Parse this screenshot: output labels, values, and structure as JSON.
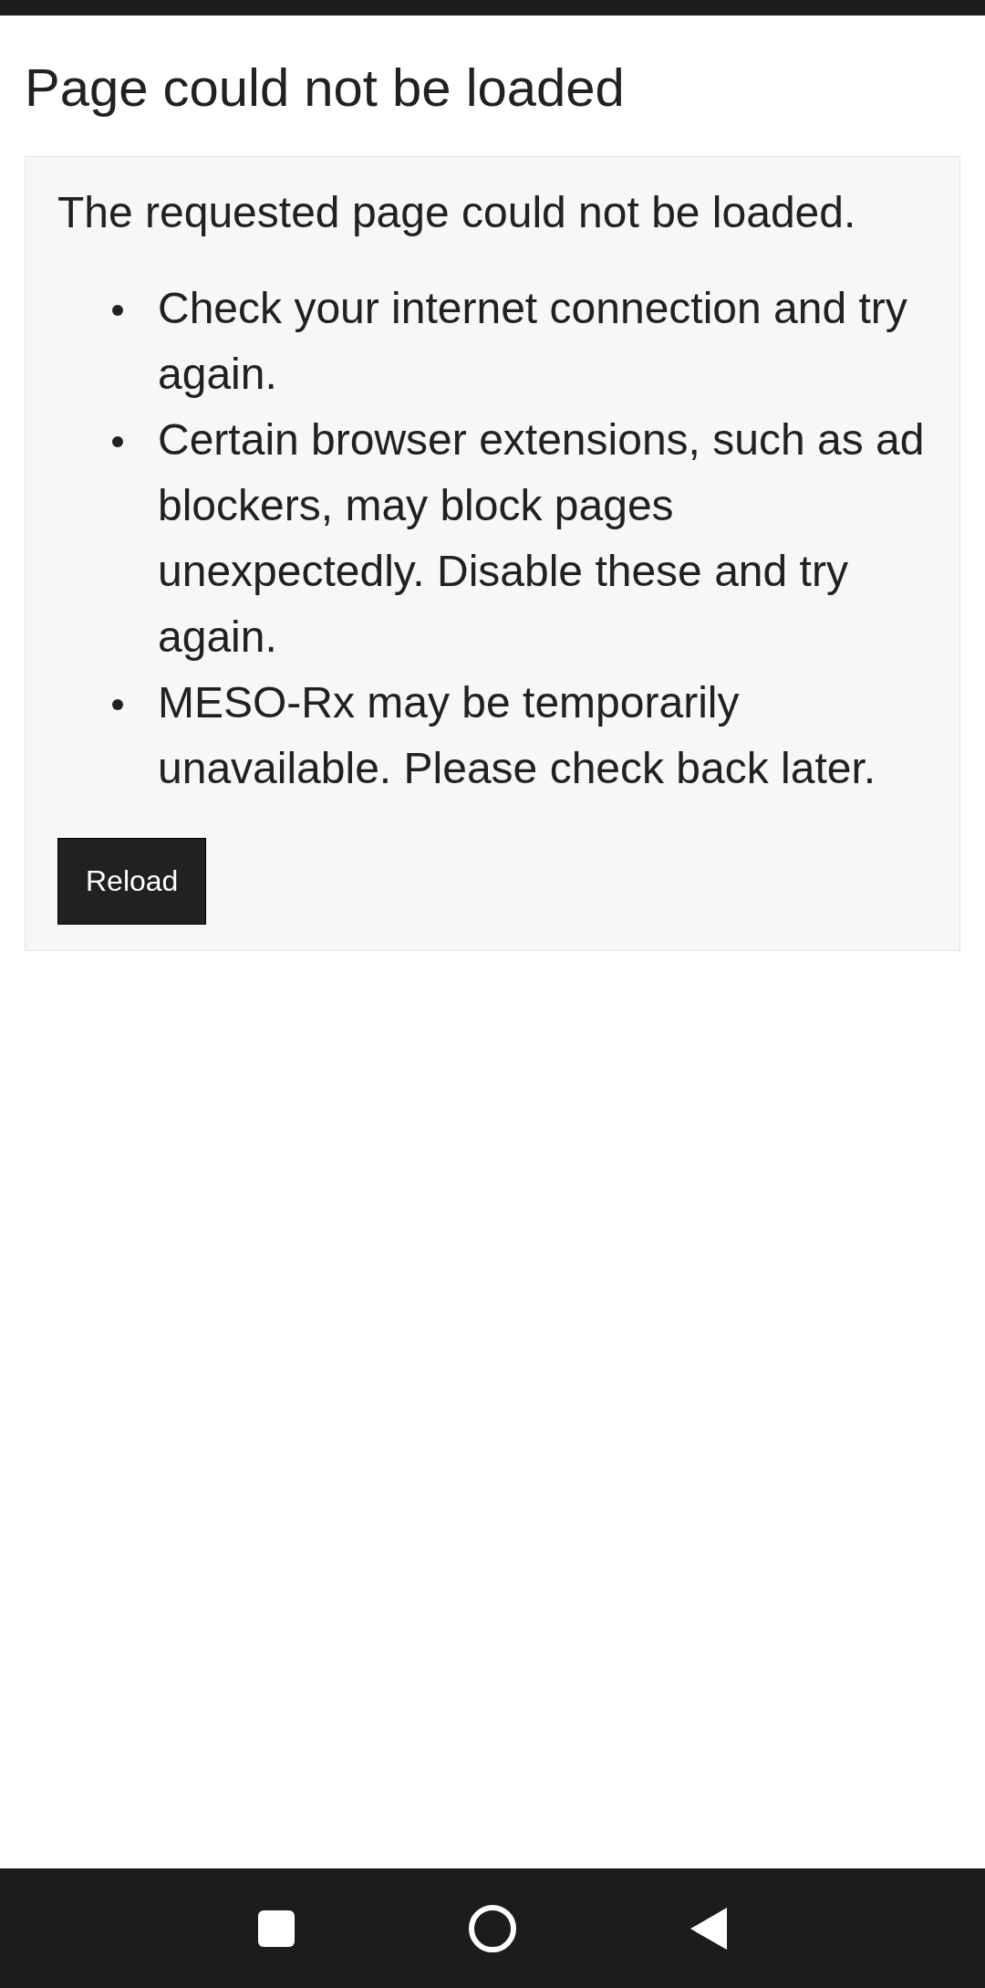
{
  "title": "Page could not be loaded",
  "message": "The requested page could not be loaded.",
  "tips": [
    "Check your internet connection and try again.",
    "Certain browser extensions, such as ad blockers, may block pages unexpectedly. Disable these and try again.",
    "MESO-Rx may be temporarily unavailable. Please check back later."
  ],
  "button": "Reload"
}
